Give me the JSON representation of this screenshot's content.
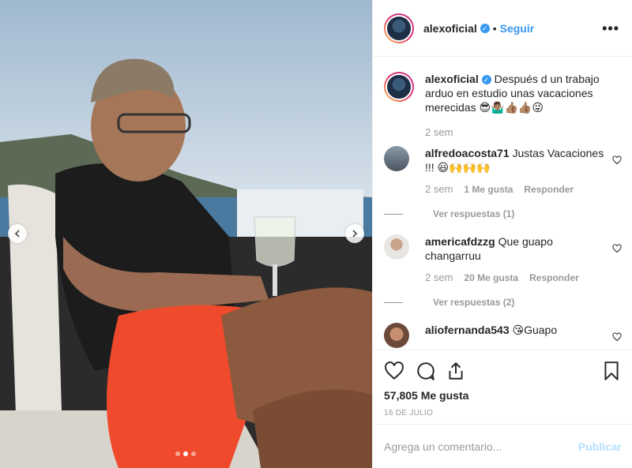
{
  "post": {
    "username": "alexoficial",
    "follow_label": "Seguir",
    "more_label": "•••"
  },
  "caption": {
    "username": "alexoficial",
    "text": "Después d un trabajo arduo en estudio unas vacaciones merecidas 😎🤷🏽‍♂️👍🏽👍🏽😜",
    "time": "2 sem"
  },
  "comments": [
    {
      "username": "alfredoacosta71",
      "text": "Justas Vacaciones !!! 😃🙌🙌🙌",
      "time": "2 sem",
      "likes": "1 Me gusta",
      "reply_label": "Responder",
      "view_replies": "Ver respuestas (1)"
    },
    {
      "username": "americafdzzg",
      "text": "Que guapo changarruu",
      "time": "2 sem",
      "likes": "20 Me gusta",
      "reply_label": "Responder",
      "view_replies": "Ver respuestas (2)"
    },
    {
      "username": "aliofernanda543",
      "text": "😘Guapo"
    }
  ],
  "stats": {
    "likes": "57,805 Me gusta",
    "date": "16 DE JULIO"
  },
  "composer": {
    "placeholder": "Agrega un comentario...",
    "publish_label": "Publicar"
  },
  "carousel": {
    "slide_count": 3,
    "active_index": 1
  }
}
